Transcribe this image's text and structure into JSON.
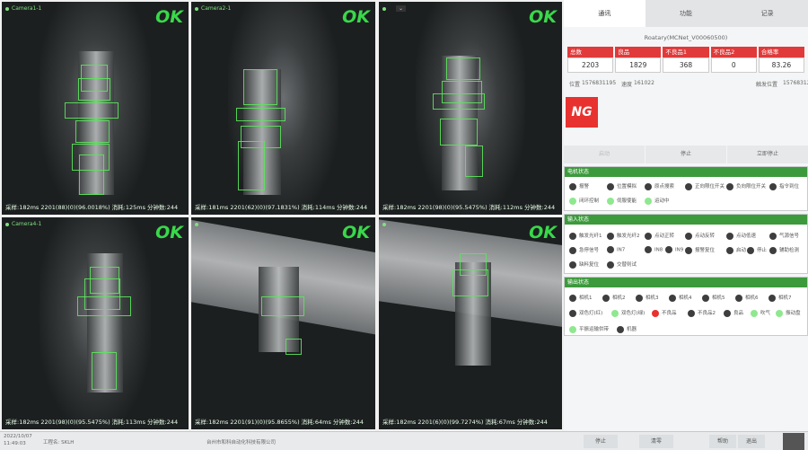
{
  "cameras": [
    {
      "name": "Camera1-1",
      "status": "OK",
      "info": "采样:182ms 2201(88)(0)(96.0018%) 消耗:125ms 分钟数:244"
    },
    {
      "name": "Camera2-1",
      "status": "OK",
      "info": "采样:181ms 2201(62)(0)(97.1831%) 消耗:114ms 分钟数:244"
    },
    {
      "name": "",
      "status": "OK",
      "info": "采样:182ms 2201(98)(0)(95.5475%) 消耗:112ms 分钟数:244"
    },
    {
      "name": "Camera4-1",
      "status": "OK",
      "info": "采样:182ms 2201(98)(0)(95.5475%) 消耗:113ms 分钟数:244"
    },
    {
      "name": "",
      "status": "OK",
      "info": "采样:182ms 2201(91)(0)(95.8655%) 消耗:64ms 分钟数:244"
    },
    {
      "name": "",
      "status": "OK",
      "info": "采样:182ms 2201(6)(0)(99.7274%) 消耗:67ms 分钟数:244"
    }
  ],
  "panel": {
    "tabs": [
      "通讯",
      "功能",
      "记录"
    ],
    "station": "Roatary(MCNet_V00060500)",
    "stats": [
      {
        "label": "总数",
        "value": "2203"
      },
      {
        "label": "良品",
        "value": "1829"
      },
      {
        "label": "不良品1",
        "value": "368"
      },
      {
        "label": "不良品2",
        "value": "0"
      },
      {
        "label": "合格率",
        "value": "83.26"
      }
    ],
    "position_label": "位置",
    "position_value": "1576831195",
    "speed_label": "速度",
    "speed_value": "161022",
    "trigger_label": "触发位置",
    "trigger_value": "15768312",
    "result": "NG",
    "buttons": [
      "启动",
      "停止",
      "立即停止"
    ],
    "motor": {
      "title": "电机状态",
      "items": [
        "报警",
        "位置模拟",
        "原点搜索",
        "正向限位开关",
        "负向限位开关",
        "指令到位",
        "闭环控制",
        "伺服使能",
        "运动中"
      ]
    },
    "inputs": {
      "title": "输入状态",
      "items": [
        "触发光纤1",
        "触发光纤2",
        "点动正转",
        "点动反转",
        "点动低速",
        "气源信号",
        "急停信号",
        "IN7",
        "IN8",
        "IN9",
        "报警复位",
        "启动",
        "停止",
        "辅助检测",
        "缺料复位",
        "交替则试"
      ]
    },
    "outputs": {
      "title": "输出状态",
      "items": [
        "相机1",
        "相机2",
        "相机3",
        "相机4",
        "相机5",
        "相机6",
        "相机7",
        "双色灯(红)",
        "双色灯(绿)",
        "不良品",
        "不良品2",
        "良品",
        "吹气",
        "振动盘",
        "平振运输供带",
        "机器"
      ]
    }
  },
  "statusbar": {
    "datetime": "2022/10/07\n11:49:03",
    "project": "工程名: SKLH",
    "company": "台州市和科自动化科技有限公司",
    "stop": "停止",
    "clear": "清零",
    "help": "帮助",
    "exit": "退出"
  }
}
